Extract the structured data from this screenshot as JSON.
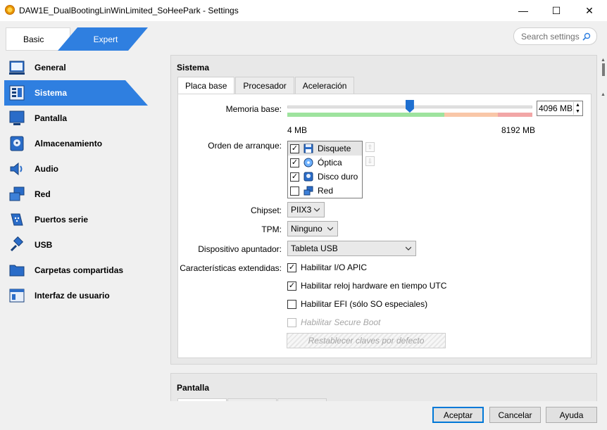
{
  "window": {
    "title": "DAW1E_DualBootingLinWinLimited_SoHeePark - Settings",
    "minimize": "—",
    "maximize": "☐",
    "close": "✕"
  },
  "mode": {
    "basic": "Basic",
    "expert": "Expert",
    "active": "Expert"
  },
  "search": {
    "placeholder": "Search settings"
  },
  "sidebar": {
    "items": [
      {
        "label": "General",
        "icon": "general-icon"
      },
      {
        "label": "Sistema",
        "icon": "system-icon",
        "active": true
      },
      {
        "label": "Pantalla",
        "icon": "display-icon"
      },
      {
        "label": "Almacenamiento",
        "icon": "storage-icon"
      },
      {
        "label": "Audio",
        "icon": "audio-icon"
      },
      {
        "label": "Red",
        "icon": "network-icon"
      },
      {
        "label": "Puertos serie",
        "icon": "serial-ports-icon"
      },
      {
        "label": "USB",
        "icon": "usb-icon"
      },
      {
        "label": "Carpetas compartidas",
        "icon": "shared-folders-icon"
      },
      {
        "label": "Interfaz de usuario",
        "icon": "user-interface-icon"
      }
    ]
  },
  "sistema": {
    "title": "Sistema",
    "tabs": [
      "Placa base",
      "Procesador",
      "Aceleración"
    ],
    "active_tab": "Placa base",
    "memory": {
      "label": "Memoria base:",
      "value": "4096 MB",
      "min_label": "4 MB",
      "max_label": "8192 MB",
      "value_mb": 4096,
      "min_mb": 4,
      "max_mb": 8192
    },
    "boot_order": {
      "label": "Orden de arranque:",
      "items": [
        {
          "label": "Disquete",
          "checked": true,
          "icon": "floppy-icon"
        },
        {
          "label": "Óptica",
          "checked": true,
          "icon": "optical-disc-icon"
        },
        {
          "label": "Disco duro",
          "checked": true,
          "icon": "hard-disk-icon"
        },
        {
          "label": "Red",
          "checked": false,
          "icon": "network-boot-icon"
        }
      ]
    },
    "chipset": {
      "label": "Chipset:",
      "value": "PIIX3"
    },
    "tpm": {
      "label": "TPM:",
      "value": "Ninguno"
    },
    "pointing_device": {
      "label": "Dispositivo apuntador:",
      "value": "Tableta USB"
    },
    "extended_features": {
      "label": "Características extendidas:",
      "items": [
        {
          "label": "Habilitar I/O APIC",
          "checked": true,
          "enabled": true
        },
        {
          "label": "Habilitar reloj hardware en tiempo UTC",
          "checked": true,
          "enabled": true
        },
        {
          "label": "Habilitar EFI (sólo SO especiales)",
          "checked": false,
          "enabled": true
        },
        {
          "label": "Habilitar Secure Boot",
          "checked": false,
          "enabled": false
        }
      ]
    },
    "reset_keys": "Restablecer claves por defecto"
  },
  "pantalla": {
    "title": "Pantalla"
  },
  "footer": {
    "accept": "Aceptar",
    "cancel": "Cancelar",
    "help": "Ayuda"
  },
  "colors": {
    "accent": "#2f7fe0",
    "slider_green": "#9ee39e",
    "slider_orange": "#f9c7a8",
    "slider_red": "#f2a6a6"
  }
}
